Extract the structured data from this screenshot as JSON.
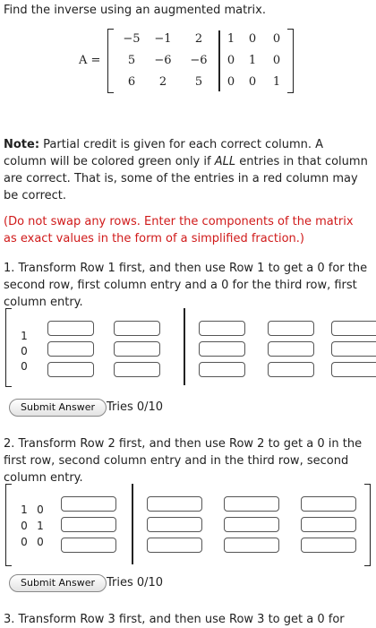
{
  "instruction": "Find the inverse using an augmented matrix.",
  "matrix": {
    "label": "A =",
    "rows": [
      [
        "−5",
        "−1",
        "2",
        "1",
        "0",
        "0"
      ],
      [
        "5",
        "−6",
        "−6",
        "0",
        "1",
        "0"
      ],
      [
        "6",
        "2",
        "5",
        "0",
        "0",
        "1"
      ]
    ]
  },
  "note": {
    "label": "Note:",
    "text_1": " Partial credit is given for each correct column. A column will be colored green only if ",
    "emphasis": "ALL",
    "text_2": " entries in that column are correct. That is, some of the entries in a red column may be correct."
  },
  "warning": "(Do not swap any rows. Enter the components of the matrix as exact values in the form of a simplified fraction.)",
  "steps": [
    {
      "prompt": "1. Transform Row 1 first, and then use Row 1 to get a 0 for the second row, first column entry and a 0 for the third row, first column entry.",
      "given_column": [
        "1",
        "0",
        "0"
      ],
      "submit_label": "Submit Answer",
      "tries": "Tries 0/10"
    },
    {
      "prompt": "2. Transform Row 2 first, and then use Row 2 to get a 0 in the first row, second column entry and in the third row, second column entry.",
      "given_columns": [
        [
          "1",
          "0"
        ],
        [
          "0",
          "1"
        ],
        [
          "0",
          "0"
        ]
      ],
      "submit_label": "Submit Answer",
      "tries": "Tries 0/10"
    },
    {
      "prompt": "3. Transform Row 3 first, and then use Row 3 to get a 0 for"
    }
  ]
}
